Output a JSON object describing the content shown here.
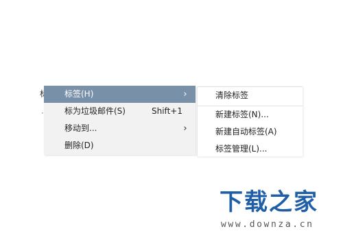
{
  "background_fragments": [
    "标",
    "·"
  ],
  "context_menu": {
    "items": [
      {
        "label": "标签(H)",
        "shortcut": "",
        "arrow": "›",
        "highlighted": true
      },
      {
        "label": "标为垃圾邮件(S)",
        "shortcut": "Shift+1",
        "arrow": "",
        "highlighted": false
      },
      {
        "label": "移动到...",
        "shortcut": "",
        "arrow": "›",
        "highlighted": false
      },
      {
        "label": "删除(D)",
        "shortcut": "",
        "arrow": "",
        "highlighted": false
      }
    ]
  },
  "submenu": {
    "items": [
      {
        "label": "清除标签"
      },
      {
        "label": "新建标签(N)..."
      },
      {
        "label": "新建自动标签(A)"
      },
      {
        "label": "标签管理(L)..."
      }
    ]
  },
  "watermark": {
    "logo_text": "下载之家",
    "url_text": "www.downza.cn"
  },
  "colors": {
    "highlight": "#7990a9",
    "menu_bg": "#f2f2f2",
    "watermark_blue": "#1f5fa8"
  }
}
